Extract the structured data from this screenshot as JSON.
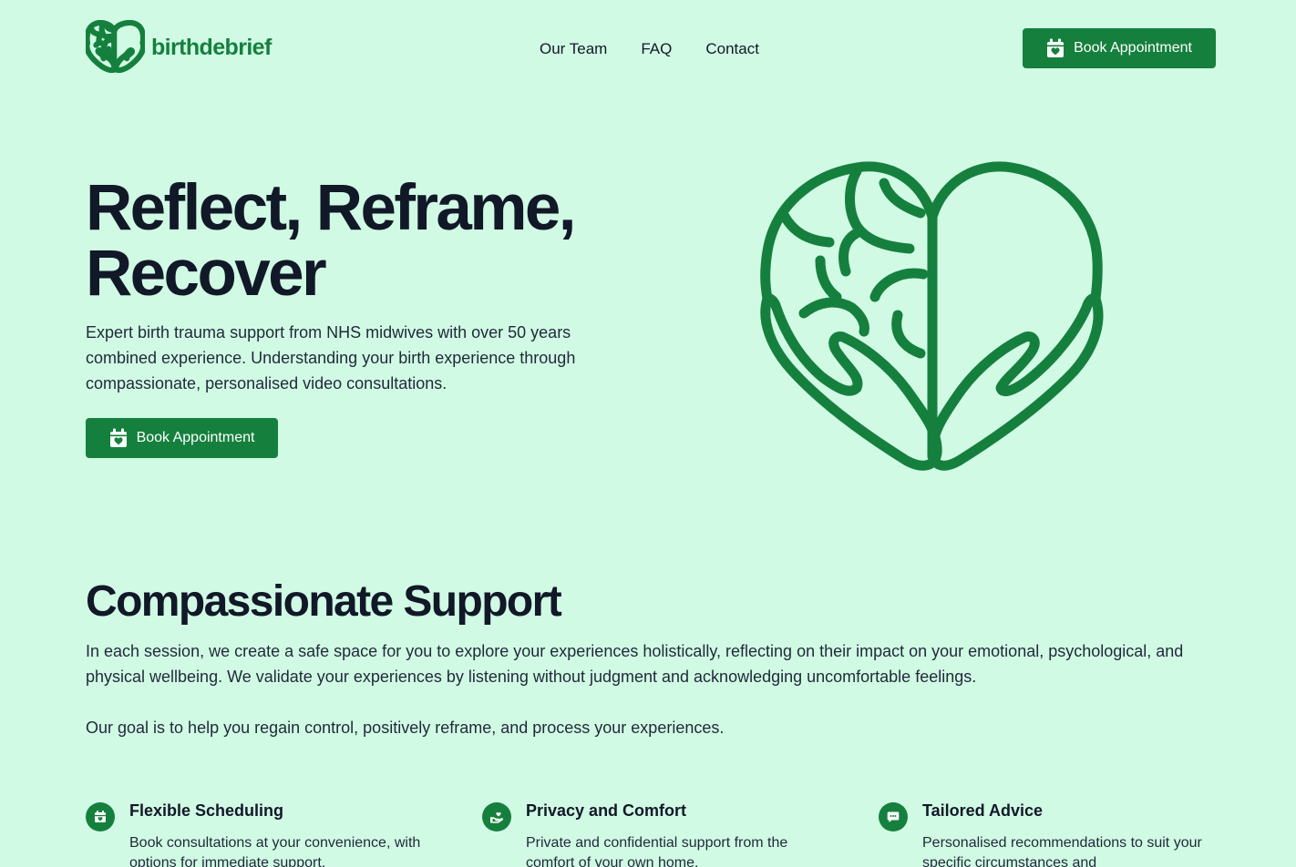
{
  "brand": {
    "name": "birthdebrief",
    "logo_icon": "brain-heart-hands-icon",
    "accent_color": "#15803d",
    "background_color": "#d1fae5"
  },
  "nav": {
    "items": [
      {
        "label": "Our Team"
      },
      {
        "label": "FAQ"
      },
      {
        "label": "Contact"
      }
    ],
    "cta_label": "Book Appointment",
    "cta_icon": "calendar-heart-icon"
  },
  "hero": {
    "title_line1": "Reflect, Reframe,",
    "title_line2": "Recover",
    "description": "Expert birth trauma support from NHS midwives with over 50 years combined experience. Understanding your birth experience through compassionate, personalised video consultations.",
    "cta_label": "Book Appointment",
    "illustration": "brain-heart-hands-icon"
  },
  "support": {
    "title": "Compassionate Support",
    "paragraph1": "In each session, we create a safe space for you to explore your experiences holistically, reflecting on their impact on your emotional, psychological, and physical wellbeing. We validate your experiences by listening without judgment and acknowledging uncomfortable feelings.",
    "paragraph2": "Our goal is to help you regain control, positively reframe, and process your experiences."
  },
  "features": [
    {
      "icon": "calendar-icon",
      "title": "Flexible Scheduling",
      "text": "Book consultations at your convenience, with options for immediate support."
    },
    {
      "icon": "hand-heart-icon",
      "title": "Privacy and Comfort",
      "text": "Private and confidential support from the comfort of your own home."
    },
    {
      "icon": "chat-icon",
      "title": "Tailored Advice",
      "text": "Personalised recommendations to suit your specific circumstances and"
    }
  ]
}
